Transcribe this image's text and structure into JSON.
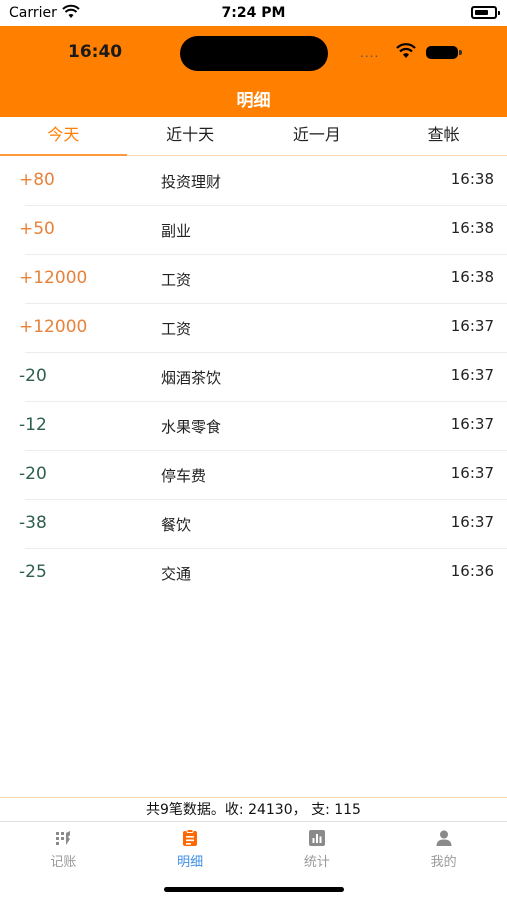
{
  "status_bar": {
    "carrier": "Carrier",
    "time": "7:24 PM"
  },
  "app_header": {
    "inner_time": "16:40",
    "inner_dots": "....",
    "title": "明细",
    "background_color": "#ff7f00"
  },
  "tabs": [
    {
      "label": "今天",
      "active": true
    },
    {
      "label": "近十天",
      "active": false
    },
    {
      "label": "近一月",
      "active": false
    },
    {
      "label": "查帐",
      "active": false
    }
  ],
  "transactions": [
    {
      "amount": "+80",
      "category": "投资理财",
      "time": "16:38",
      "type": "income"
    },
    {
      "amount": "+50",
      "category": "副业",
      "time": "16:38",
      "type": "income"
    },
    {
      "amount": "+12000",
      "category": "工资",
      "time": "16:38",
      "type": "income"
    },
    {
      "amount": "+12000",
      "category": "工资",
      "time": "16:37",
      "type": "income"
    },
    {
      "amount": "-20",
      "category": "烟酒茶饮",
      "time": "16:37",
      "type": "expense"
    },
    {
      "amount": "-12",
      "category": "水果零食",
      "time": "16:37",
      "type": "expense"
    },
    {
      "amount": "-20",
      "category": "停车费",
      "time": "16:37",
      "type": "expense"
    },
    {
      "amount": "-38",
      "category": "餐饮",
      "time": "16:37",
      "type": "expense"
    },
    {
      "amount": "-25",
      "category": "交通",
      "time": "16:36",
      "type": "expense"
    }
  ],
  "summary": {
    "text": "共9笔数据。收: 24130， 支: 115"
  },
  "tabbar": [
    {
      "label": "记账",
      "icon": "bookkeeping-icon",
      "active": false
    },
    {
      "label": "明细",
      "icon": "detail-list-icon",
      "active": true
    },
    {
      "label": "统计",
      "icon": "chart-icon",
      "active": false
    },
    {
      "label": "我的",
      "icon": "person-icon",
      "active": false
    }
  ],
  "colors": {
    "accent": "#ff7f00",
    "income": "#e8823a",
    "expense": "#2e5e4e",
    "tab_active": "#3c8ee6"
  }
}
